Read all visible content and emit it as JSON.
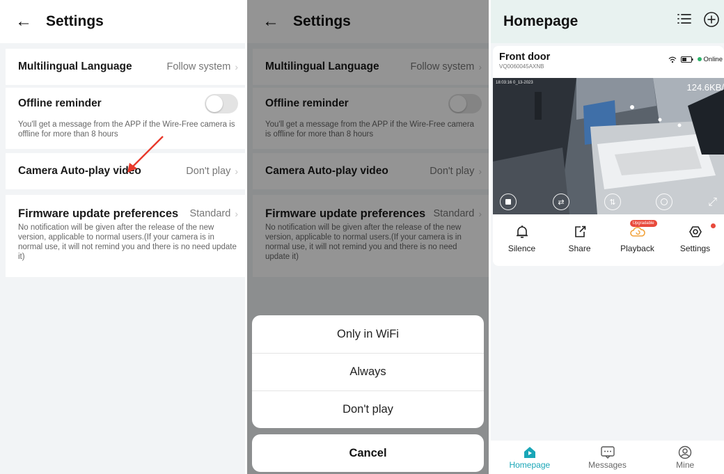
{
  "settings": {
    "back_glyph": "←",
    "title": "Settings",
    "language": {
      "label": "Multilingual Language",
      "value": "Follow system"
    },
    "offline": {
      "label": "Offline reminder",
      "enabled": false,
      "desc": "You'll get a message from the APP if the Wire-Free camera is offline for more than 8 hours"
    },
    "autoplay": {
      "label": "Camera Auto-play video",
      "value": "Don't play"
    },
    "firmware": {
      "label": "Firmware update preferences",
      "value": "Standard",
      "desc": "No notification will be given after the release of the new version, applicable to normal users.(If your camera is in normal use, it will not remind you and there is no need update it)"
    },
    "chevron": "›"
  },
  "sheet": {
    "options": [
      "Only in WiFi",
      "Always",
      "Don't play"
    ],
    "cancel": "Cancel"
  },
  "homepage": {
    "title": "Homepage",
    "device": {
      "name": "Front door",
      "serial": "VQ0060045AXNB",
      "status": "Online",
      "timestamp": "18:03:16 0_13-2023",
      "rate": "124.6KB/"
    },
    "actions": [
      {
        "label": "Silence",
        "icon": "bell-icon"
      },
      {
        "label": "Share",
        "icon": "share-icon"
      },
      {
        "label": "Playback",
        "icon": "playback-cloud-icon",
        "badge": "Upgradable"
      },
      {
        "label": "Settings",
        "icon": "settings-icon"
      }
    ],
    "tabs": [
      {
        "label": "Homepage",
        "icon": "home-icon",
        "active": true
      },
      {
        "label": "Messages",
        "icon": "messages-icon",
        "active": false
      },
      {
        "label": "Mine",
        "icon": "user-icon",
        "active": false
      }
    ]
  },
  "colors": {
    "accent": "#19a6b7",
    "annotation_arrow": "#e8392b",
    "online": "#2fb36b",
    "badge": "#e84a3c"
  }
}
